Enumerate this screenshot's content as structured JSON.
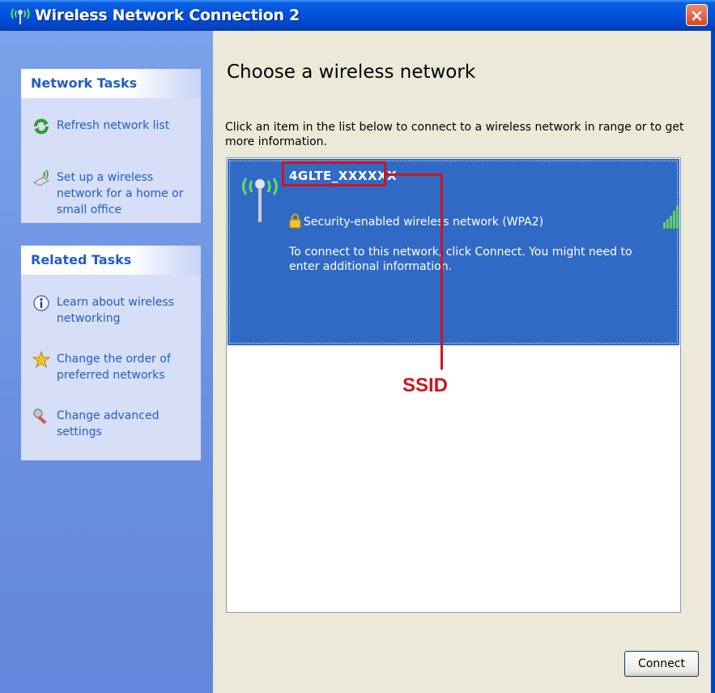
{
  "window": {
    "title": "Wireless Network Connection 2",
    "close_label": "×"
  },
  "sidebar": {
    "network_tasks": {
      "title": "Network Tasks",
      "items": [
        {
          "label": "Refresh network list",
          "icon": "refresh-icon"
        },
        {
          "label": "Set up a wireless network for a home or small office",
          "icon": "setup-wireless-icon"
        }
      ]
    },
    "related_tasks": {
      "title": "Related Tasks",
      "items": [
        {
          "label": "Learn about wireless networking",
          "icon": "info-icon"
        },
        {
          "label": "Change the order of preferred networks",
          "icon": "star-icon"
        },
        {
          "label": "Change advanced settings",
          "icon": "tools-icon"
        }
      ]
    }
  },
  "main": {
    "heading": "Choose a wireless network",
    "instruction": "Click an item in the list below to connect to a wireless network in range or to get more information.",
    "networks": [
      {
        "ssid": "4GLTE_XXXXXX",
        "security": "Security-enabled wireless network (WPA2)",
        "description": "To connect to this network, click Connect. You might need to enter additional information.",
        "selected": true,
        "signal_level": 1.0
      }
    ],
    "connect_label": "Connect"
  },
  "annotation": {
    "label": "SSID",
    "color": "#d0131c"
  },
  "colors": {
    "titlebar": "#0050d8",
    "selection": "#316ac5",
    "sidebar": "#7aa2ea",
    "link": "#215dc6"
  }
}
